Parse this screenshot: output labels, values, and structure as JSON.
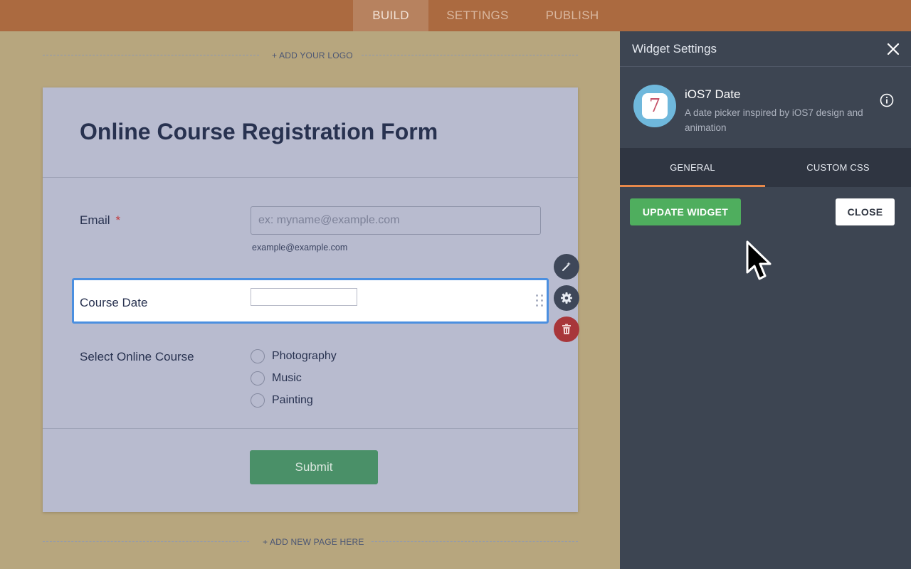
{
  "topbar": {
    "tabs": [
      {
        "label": "BUILD",
        "active": true
      },
      {
        "label": "SETTINGS",
        "active": false
      },
      {
        "label": "PUBLISH",
        "active": false
      }
    ]
  },
  "builder": {
    "add_logo": "+ ADD YOUR LOGO",
    "add_page": "+ ADD NEW PAGE HERE"
  },
  "form": {
    "title": "Online Course Registration Form",
    "email": {
      "label": "Email",
      "required_mark": "*",
      "placeholder": "ex: myname@example.com",
      "sublabel": "example@example.com"
    },
    "course_date": {
      "label": "Course Date",
      "value": ""
    },
    "course_select": {
      "label": "Select Online Course",
      "options": [
        "Photography",
        "Music",
        "Painting"
      ]
    },
    "submit_label": "Submit"
  },
  "field_actions": {
    "icons": [
      "magic-wand-icon",
      "gear-icon",
      "trash-icon"
    ]
  },
  "panel": {
    "title": "Widget Settings",
    "widget": {
      "name": "iOS7 Date",
      "description": "A date picker inspired by iOS7 design and animation",
      "icon_glyph": "7"
    },
    "tabs": [
      {
        "label": "GENERAL",
        "active": true
      },
      {
        "label": "CUSTOM CSS",
        "active": false
      }
    ],
    "update_label": "UPDATE WIDGET",
    "close_label": "CLOSE"
  },
  "colors": {
    "topbar": "#ab6a40",
    "canvas": "#b7a67e",
    "panel": "#3d4552",
    "accent_tab": "#e7894b",
    "update_button": "#4fae5e",
    "submit_button": "#4a9068",
    "selected_border": "#4b8fe0",
    "delete_button": "#a8363a"
  }
}
